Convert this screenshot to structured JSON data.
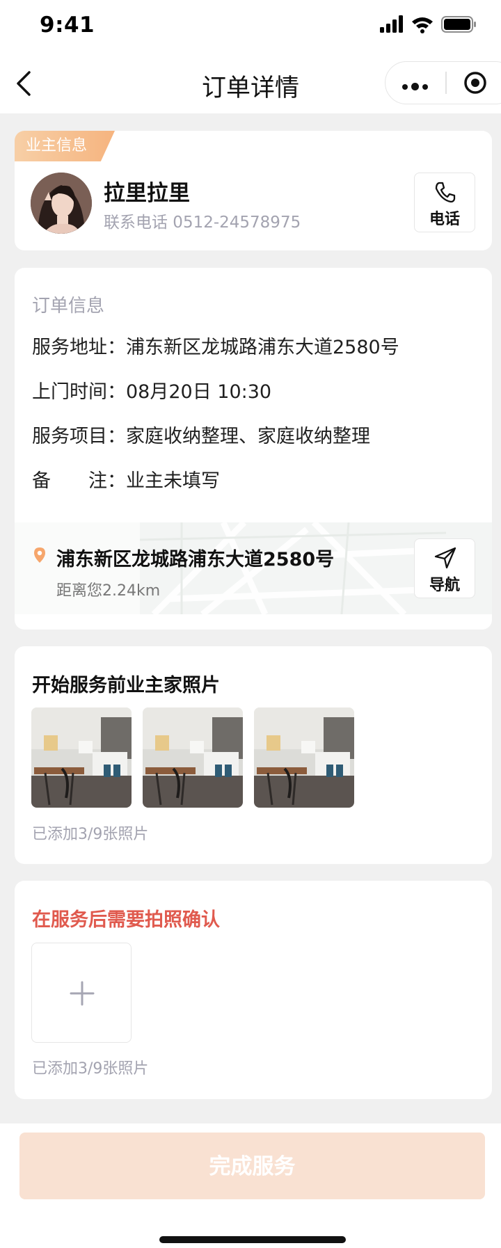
{
  "status_bar": {
    "time": "9:41"
  },
  "nav": {
    "title": "订单详情"
  },
  "owner": {
    "tag": "业主信息",
    "name": "拉里拉里",
    "phone": "联系电话 0512-24578975",
    "call_label": "电话",
    "icon": "phone-icon"
  },
  "order": {
    "section_title": "订单信息",
    "rows": [
      {
        "key": "服务地址：",
        "value": "浦东新区龙城路浦东大道2580号"
      },
      {
        "key": "上门时间：",
        "value": "08月20日 10:30"
      },
      {
        "key": "服务项目：",
        "value": "家庭收纳整理、家庭收纳整理"
      },
      {
        "key": "备　　注：",
        "value": "业主未填写"
      }
    ],
    "address": "浦东新区龙城路浦东大道2580号",
    "distance": "距离您2.24km",
    "nav_label": "导航",
    "nav_icon": "navigation-icon"
  },
  "before_photos": {
    "title": "开始服务前业主家照片",
    "count_text": "已添加3/9张照片",
    "photos": [
      "room-photo",
      "room-photo",
      "room-photo"
    ]
  },
  "after_photos": {
    "title": "在服务后需要拍照确认",
    "count_text": "已添加3/9张照片",
    "add_icon": "plus-icon"
  },
  "footer": {
    "button_label": "完成服务"
  },
  "colors": {
    "accent": "#f6b47f",
    "warning_text": "#e05a4e",
    "disabled_button": "#f9e1d2"
  }
}
